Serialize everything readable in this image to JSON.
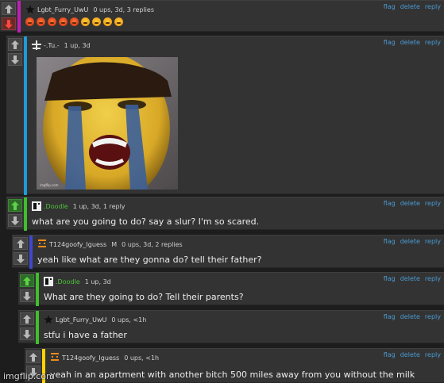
{
  "colors": {
    "link": "#4a9bd4",
    "green_name": "#4fc23a",
    "bar_magenta": "#c01fb6",
    "bar_blue": "#1f9ad6",
    "bar_green": "#3fbf2c",
    "bar_indigo": "#3f48cc",
    "bar_yellow": "#ffd200"
  },
  "actions": {
    "flag": "flag",
    "delete": "delete",
    "reply": "reply"
  },
  "comments": [
    {
      "username": "Lgbt_Furry_UwU",
      "badge": "",
      "stats": "0 ups, 3d, 3 replies",
      "text": "",
      "emoji_count": 9,
      "vote": "down",
      "avatar_icon": "star-icon"
    },
    {
      "username": "-.Tu.-",
      "badge": "",
      "stats": "1 up, 3d",
      "text": "",
      "vote": "none",
      "avatar_icon": "cross-icon"
    },
    {
      "username": ".Doodle",
      "badge": "",
      "stats": "1 up, 3d, 1 reply",
      "text": "what are you going to do? say a slur? I'm so scared.",
      "vote": "up",
      "avatar_icon": "pixel-face-icon"
    },
    {
      "username": "T124goofy_Iguess",
      "badge": "M",
      "stats": "0 ups, 3d, 2 replies",
      "text": "yeah like what are they gonna do? tell their father?",
      "vote": "none",
      "avatar_icon": "orange-face-icon"
    },
    {
      "username": ".Doodle",
      "badge": "",
      "stats": "1 up, 3d",
      "text": "What are they going to do? Tell their parents?",
      "vote": "up",
      "avatar_icon": "pixel-face-icon"
    },
    {
      "username": "Lgbt_Furry_UwU",
      "badge": "",
      "stats": "0 ups, <1h",
      "text": "stfu i have a father",
      "vote": "none",
      "avatar_icon": "star-icon"
    },
    {
      "username": "T124goofy_Iguess",
      "badge": "",
      "stats": "0 ups, <1h",
      "text": "yeah in an apartment with another bitch 500 miles away from you without the milk",
      "vote": "none",
      "avatar_icon": "orange-face-icon"
    }
  ],
  "watermark": "imgflip.com"
}
